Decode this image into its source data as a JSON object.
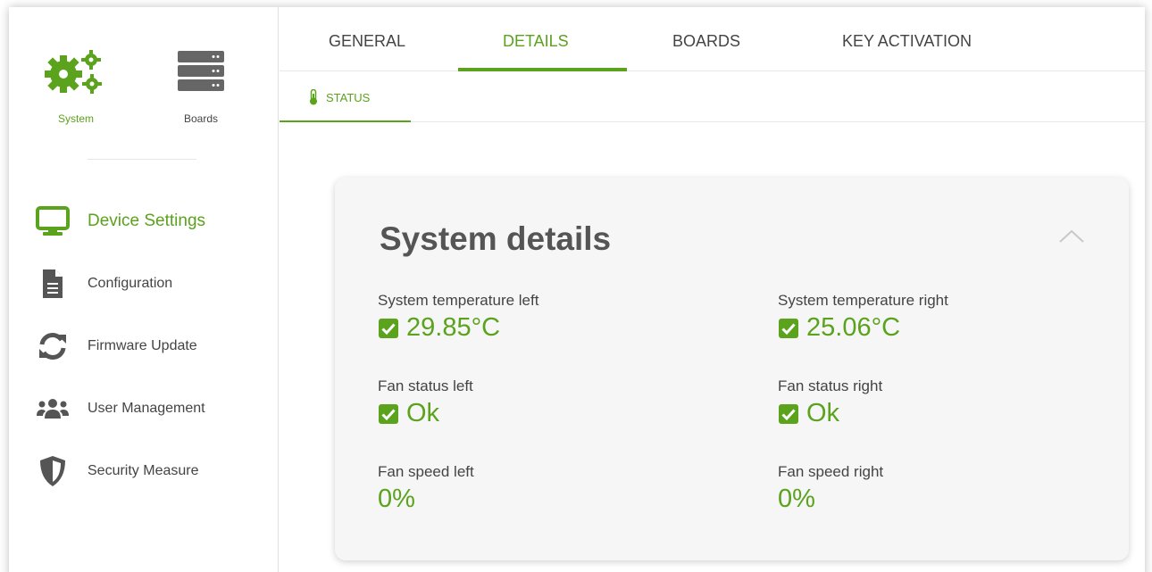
{
  "colors": {
    "accent": "#5ba21d",
    "text": "#444444",
    "card_bg": "#f6f6f6"
  },
  "sidebar": {
    "top_icons": [
      {
        "label": "System",
        "icon": "gears-icon",
        "active": true
      },
      {
        "label": "Boards",
        "icon": "server-icon",
        "active": false
      }
    ],
    "items": [
      {
        "label": "Device Settings",
        "icon": "monitor-icon",
        "active": true
      },
      {
        "label": "Configuration",
        "icon": "document-icon",
        "active": false
      },
      {
        "label": "Firmware Update",
        "icon": "refresh-icon",
        "active": false
      },
      {
        "label": "User Management",
        "icon": "users-icon",
        "active": false
      },
      {
        "label": "Security Measure",
        "icon": "shield-icon",
        "active": false
      }
    ]
  },
  "tabs": [
    {
      "label": "GENERAL",
      "active": false
    },
    {
      "label": "DETAILS",
      "active": true
    },
    {
      "label": "BOARDS",
      "active": false
    },
    {
      "label": "KEY ACTIVATION",
      "active": false
    }
  ],
  "subtabs": [
    {
      "label": "STATUS",
      "icon": "thermometer-icon",
      "active": true
    }
  ],
  "card": {
    "title": "System details",
    "collapse_icon": "chevron-up-icon",
    "fields": [
      {
        "label": "System temperature left",
        "value": "29.85°C",
        "checked": true
      },
      {
        "label": "System temperature right",
        "value": "25.06°C",
        "checked": true
      },
      {
        "label": "Fan status left",
        "value": "Ok",
        "checked": true
      },
      {
        "label": "Fan status right",
        "value": "Ok",
        "checked": true
      },
      {
        "label": "Fan speed left",
        "value": "0%",
        "checked": false
      },
      {
        "label": "Fan speed right",
        "value": "0%",
        "checked": false
      }
    ]
  }
}
